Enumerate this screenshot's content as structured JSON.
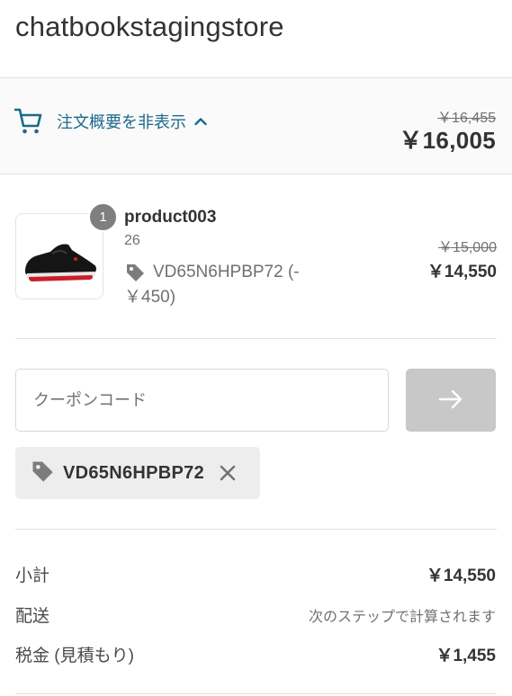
{
  "header": {
    "store_name": "chatbookstagingstore"
  },
  "summary_toggle": {
    "label": "注文概要を非表示",
    "original_total": "￥16,455",
    "total": "￥16,005"
  },
  "product": {
    "quantity": "1",
    "name": "product003",
    "variant": "26",
    "discount": "VD65N6HPBP72 (-￥450)",
    "original_price": "￥15,000",
    "price": "￥14,550"
  },
  "coupon": {
    "placeholder": "クーポンコード",
    "value": "",
    "applied_code": "VD65N6HPBP72"
  },
  "totals": {
    "subtotal_label": "小計",
    "subtotal_value": "￥14,550",
    "shipping_label": "配送",
    "shipping_value": "次のステップで計算されます",
    "tax_label": "税金 (見積もり)",
    "tax_value": "￥1,455"
  },
  "colors": {
    "link": "#1b6a8c",
    "button_disabled": "#c8c8c8",
    "tag_bg": "#ededed"
  },
  "icons": [
    "cart-icon",
    "chevron-up-icon",
    "discount-tag-icon",
    "arrow-right-icon",
    "close-icon"
  ]
}
